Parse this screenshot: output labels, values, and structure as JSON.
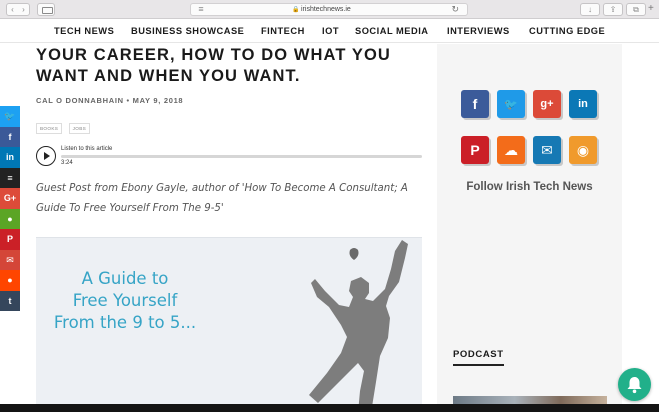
{
  "browser": {
    "url": "irishtechnews.ie",
    "back": "‹",
    "forward": "›",
    "reload": "↻",
    "share": "⇪",
    "tabs": "⧉",
    "new_tab": "+",
    "download": "↓"
  },
  "nav": [
    "TECH NEWS",
    "BUSINESS SHOWCASE",
    "FINTECH",
    "IOT",
    "SOCIAL MEDIA",
    "INTERVIEWS",
    "CUTTING EDGE"
  ],
  "social_bar": [
    {
      "icon": "twitter-icon",
      "glyph": "🐦",
      "color": "#1da1f2"
    },
    {
      "icon": "facebook-icon",
      "glyph": "f",
      "color": "#3b5998"
    },
    {
      "icon": "linkedin-icon",
      "glyph": "in",
      "color": "#0077b5"
    },
    {
      "icon": "buffer-icon",
      "glyph": "≡",
      "color": "#222222"
    },
    {
      "icon": "google-plus-icon",
      "glyph": "G+",
      "color": "#dd4b39"
    },
    {
      "icon": "evernote-icon",
      "glyph": "●",
      "color": "#5ba525"
    },
    {
      "icon": "pinterest-icon",
      "glyph": "P",
      "color": "#cb2027"
    },
    {
      "icon": "email-icon",
      "glyph": "✉",
      "color": "#d44638"
    },
    {
      "icon": "reddit-icon",
      "glyph": "●",
      "color": "#ff4500"
    },
    {
      "icon": "tumblr-icon",
      "glyph": "t",
      "color": "#35465c"
    }
  ],
  "article": {
    "title": "YOUR CAREER, HOW TO DO WHAT YOU WANT AND WHEN YOU WANT.",
    "author": "CAL O DONNABHAIN",
    "date": "MAY 9, 2018",
    "tags": [
      "BOOKS",
      "JOBS"
    ],
    "player": {
      "listen_label": "Listen to this article",
      "duration": "3:24"
    },
    "lead": "Guest Post from Ebony Gayle, author of 'How To Become A Consultant; A Guide To Free Yourself From The 9-5'",
    "hero_text": [
      "A Guide to",
      "Free Yourself",
      "From the 9 to 5..."
    ]
  },
  "sidebar": {
    "icons": [
      {
        "icon": "facebook-icon",
        "glyph": "f",
        "color": "#3b5b9a"
      },
      {
        "icon": "twitter-icon",
        "glyph": "🐦",
        "color": "#1f9ae8"
      },
      {
        "icon": "google-plus-icon",
        "glyph": "g+",
        "color": "#dc4a38"
      },
      {
        "icon": "linkedin-icon",
        "glyph": "in",
        "color": "#0b78b6"
      },
      {
        "icon": "pinterest-icon",
        "glyph": "P",
        "color": "#cb1f27"
      },
      {
        "icon": "soundcloud-icon",
        "glyph": "☁",
        "color": "#f36c1a"
      },
      {
        "icon": "email-icon",
        "glyph": "✉",
        "color": "#1679b4"
      },
      {
        "icon": "rss-icon",
        "glyph": "◉",
        "color": "#f09a2c"
      }
    ],
    "follow_label": "Follow Irish Tech News",
    "podcast_heading": "PODCAST"
  }
}
